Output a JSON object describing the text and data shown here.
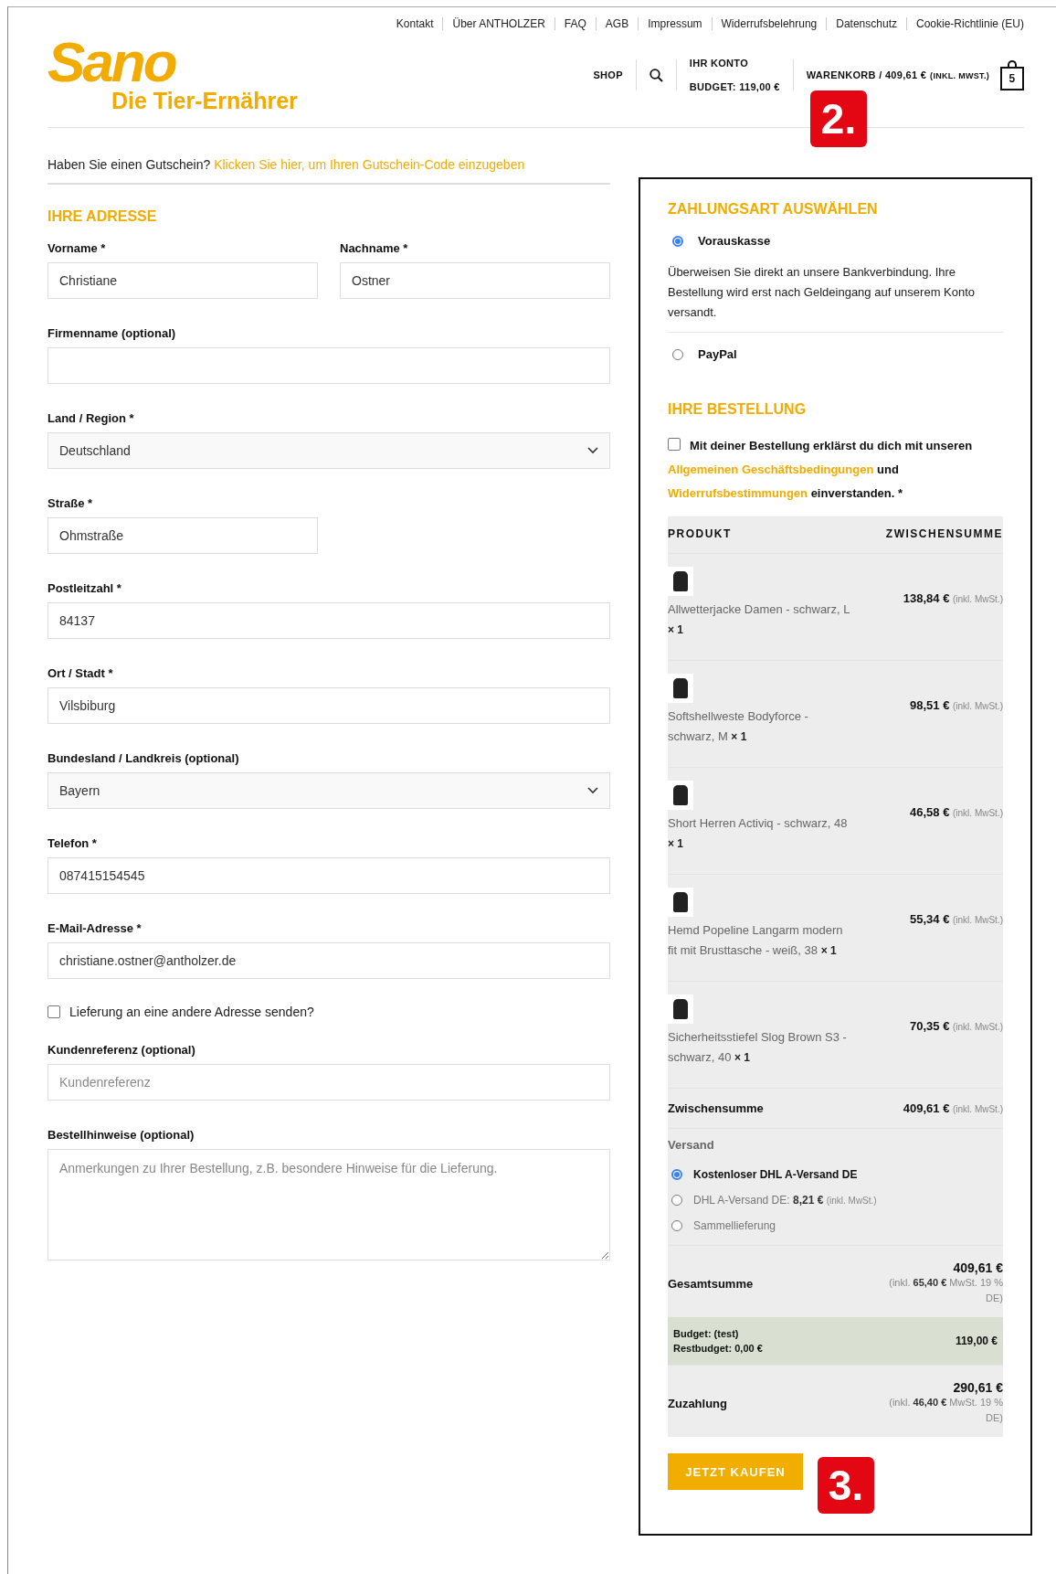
{
  "top_links": [
    "Kontakt",
    "Über ANTHOLZER",
    "FAQ",
    "AGB",
    "Impressum",
    "Widerrufsbelehrung",
    "Datenschutz",
    "Cookie-Richtlinie (EU)"
  ],
  "logo": {
    "wordmark": "Sano",
    "tagline": "Die Tier-Ernährer"
  },
  "header_nav": {
    "shop": "SHOP",
    "account_title": "IHR KONTO",
    "account_budget": "BUDGET: 119,00 €",
    "cart_label": "WARENKORB / 409,61 €",
    "cart_tax": "(INKL. MWST.)",
    "cart_count": "5"
  },
  "annotations": [
    {
      "label": "2."
    },
    {
      "label": "3."
    }
  ],
  "coupon": {
    "text": "Haben Sie einen Gutschein?",
    "link": "Klicken Sie hier, um Ihren Gutschein-Code einzugeben"
  },
  "address": {
    "title": "IHRE ADRESSE",
    "fields": [
      {
        "kind": "short",
        "label": "Vorname *",
        "value": "Christiane"
      },
      {
        "kind": "short",
        "label": "Nachname *",
        "value": "Ostner"
      },
      {
        "kind": "text",
        "label": "Firmenname (optional)"
      },
      {
        "kind": "select",
        "label": "Land / Region *",
        "value": "Deutschland"
      },
      {
        "kind": "short",
        "label": "Straße *",
        "value": "Ohmstraße"
      },
      {
        "kind": "text",
        "label": "Postleitzahl *",
        "value": "84137"
      },
      {
        "kind": "text",
        "label": "Ort / Stadt *",
        "value": "Vilsbiburg"
      },
      {
        "kind": "select",
        "label": "Bundesland / Landkreis (optional)",
        "value": "Bayern"
      },
      {
        "kind": "text",
        "label": "Telefon *",
        "value": "087415154545"
      },
      {
        "kind": "text",
        "label": "E-Mail-Adresse *",
        "value": "christiane.ostner@antholzer.de"
      },
      {
        "kind": "checkbox",
        "label": "Lieferung an eine andere Adresse senden?",
        "checked": false
      },
      {
        "kind": "text",
        "label": "Kundenreferenz (optional)",
        "placeholder": "Kundenreferenz"
      },
      {
        "kind": "textarea",
        "label": "Bestellhinweise (optional)",
        "placeholder": "Anmerkungen zu Ihrer Bestellung, z.B. besondere Hinweise für die Lieferung."
      }
    ]
  },
  "payment": {
    "title": "ZAHLUNGSART AUSWÄHLEN",
    "methods": [
      {
        "label": "Vorauskasse",
        "selected": true,
        "description": "Überweisen Sie direkt an unsere Bankverbindung. Ihre Bestellung wird erst nach Geldeingang auf unserem Konto versandt."
      },
      {
        "label": "PayPal",
        "selected": false
      }
    ]
  },
  "order": {
    "title": "IHRE BESTELLUNG",
    "terms": {
      "checked": false,
      "parts": [
        {
          "kind": "text",
          "text": "Mit deiner Bestellung erklärst du dich mit unseren"
        },
        {
          "kind": "link",
          "text": "Allgemeinen Geschäftsbedingungen"
        },
        {
          "kind": "text",
          "text": "und"
        },
        {
          "kind": "link",
          "text": "Widerrufsbestimmungen"
        },
        {
          "kind": "text",
          "text": "einverstanden.  *"
        }
      ]
    },
    "columns": [
      "PRODUKT",
      "ZWISCHENSUMME"
    ],
    "items": [
      {
        "name": "Allwetterjacke Damen - schwarz, L",
        "qty": "× 1",
        "price": "138,84 €",
        "tax": "(inkl. MwSt.)"
      },
      {
        "name": "Softshellweste Bodyforce - schwarz, M",
        "qty": "× 1",
        "price": "98,51 €",
        "tax": "(inkl. MwSt.)"
      },
      {
        "name": "Short Herren Activiq - schwarz, 48",
        "qty": "× 1",
        "price": "46,58 €",
        "tax": "(inkl. MwSt.)"
      },
      {
        "name": "Hemd Popeline Langarm modern fit mit Brusttasche - weiß, 38",
        "qty": "× 1",
        "price": "55,34 €",
        "tax": "(inkl. MwSt.)"
      },
      {
        "name": "Sicherheitsstiefel Slog Brown S3 - schwarz, 40",
        "qty": "× 1",
        "price": "70,35 €",
        "tax": "(inkl. MwSt.)"
      }
    ],
    "subtotal": {
      "label": "Zwischensumme",
      "amount": "409,61 €",
      "tax": "(inkl. MwSt.)"
    },
    "shipping": {
      "label": "Versand",
      "options": [
        {
          "label": "Kostenloser DHL A-Versand DE",
          "selected": true
        },
        {
          "label": "DHL A-Versand DE:",
          "amount": "8,21 €",
          "tax": "(inkl. MwSt.)",
          "selected": false
        },
        {
          "label": "Sammellieferung",
          "selected": false
        }
      ]
    },
    "total": {
      "label": "Gesamtsumme",
      "amount": "409,61 €",
      "tax": "(inkl. **65,40 €** MwSt. 19 % DE)"
    },
    "budget": {
      "lines": [
        "Budget: (test)",
        "Restbudget: 0,00 €"
      ],
      "amount": "119,00 €"
    },
    "copay": {
      "label": "Zuzahlung",
      "amount": "290,61 €",
      "tax": "(inkl. **46,40 €**  MwSt. 19 % DE)"
    },
    "button": "JETZT KAUFEN"
  }
}
